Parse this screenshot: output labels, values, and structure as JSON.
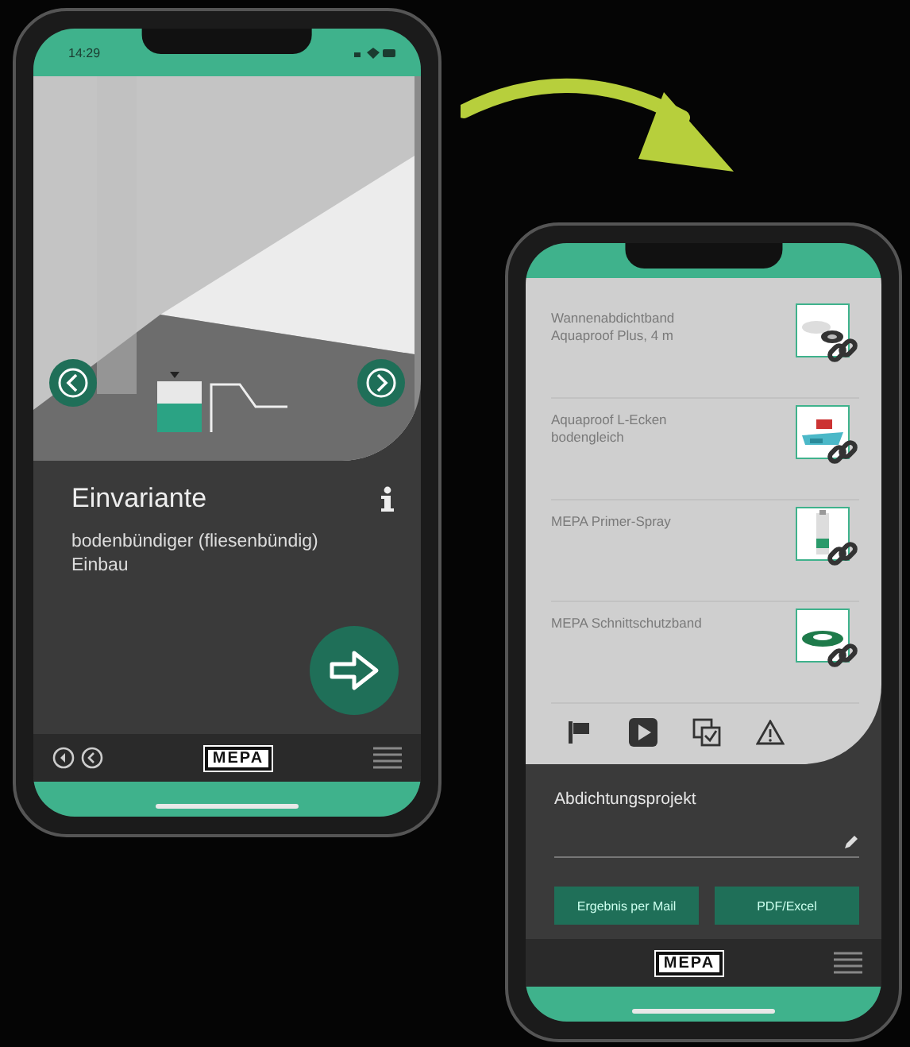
{
  "left_phone": {
    "status_time": "14:29",
    "title": "Einvariante",
    "description": "bodenbündiger (fliesenbündig) Einbau",
    "logo": "MEPA"
  },
  "right_phone": {
    "products": [
      {
        "name": "Wannenabdichtband Aquaproof Plus, 4 m"
      },
      {
        "name": "Aquaproof L-Ecken bodengleich"
      },
      {
        "name": "MEPA Primer-Spray"
      },
      {
        "name": "MEPA Schnittschutzband"
      }
    ],
    "tabs": [
      {
        "kind": "flag"
      },
      {
        "kind": "play"
      },
      {
        "kind": "checklist"
      },
      {
        "kind": "warning"
      }
    ],
    "project_title": "Abdichtungsprojekt",
    "buttons": [
      "Ergebnis per Mail",
      "PDF/Excel"
    ],
    "logo": "MEPA"
  }
}
